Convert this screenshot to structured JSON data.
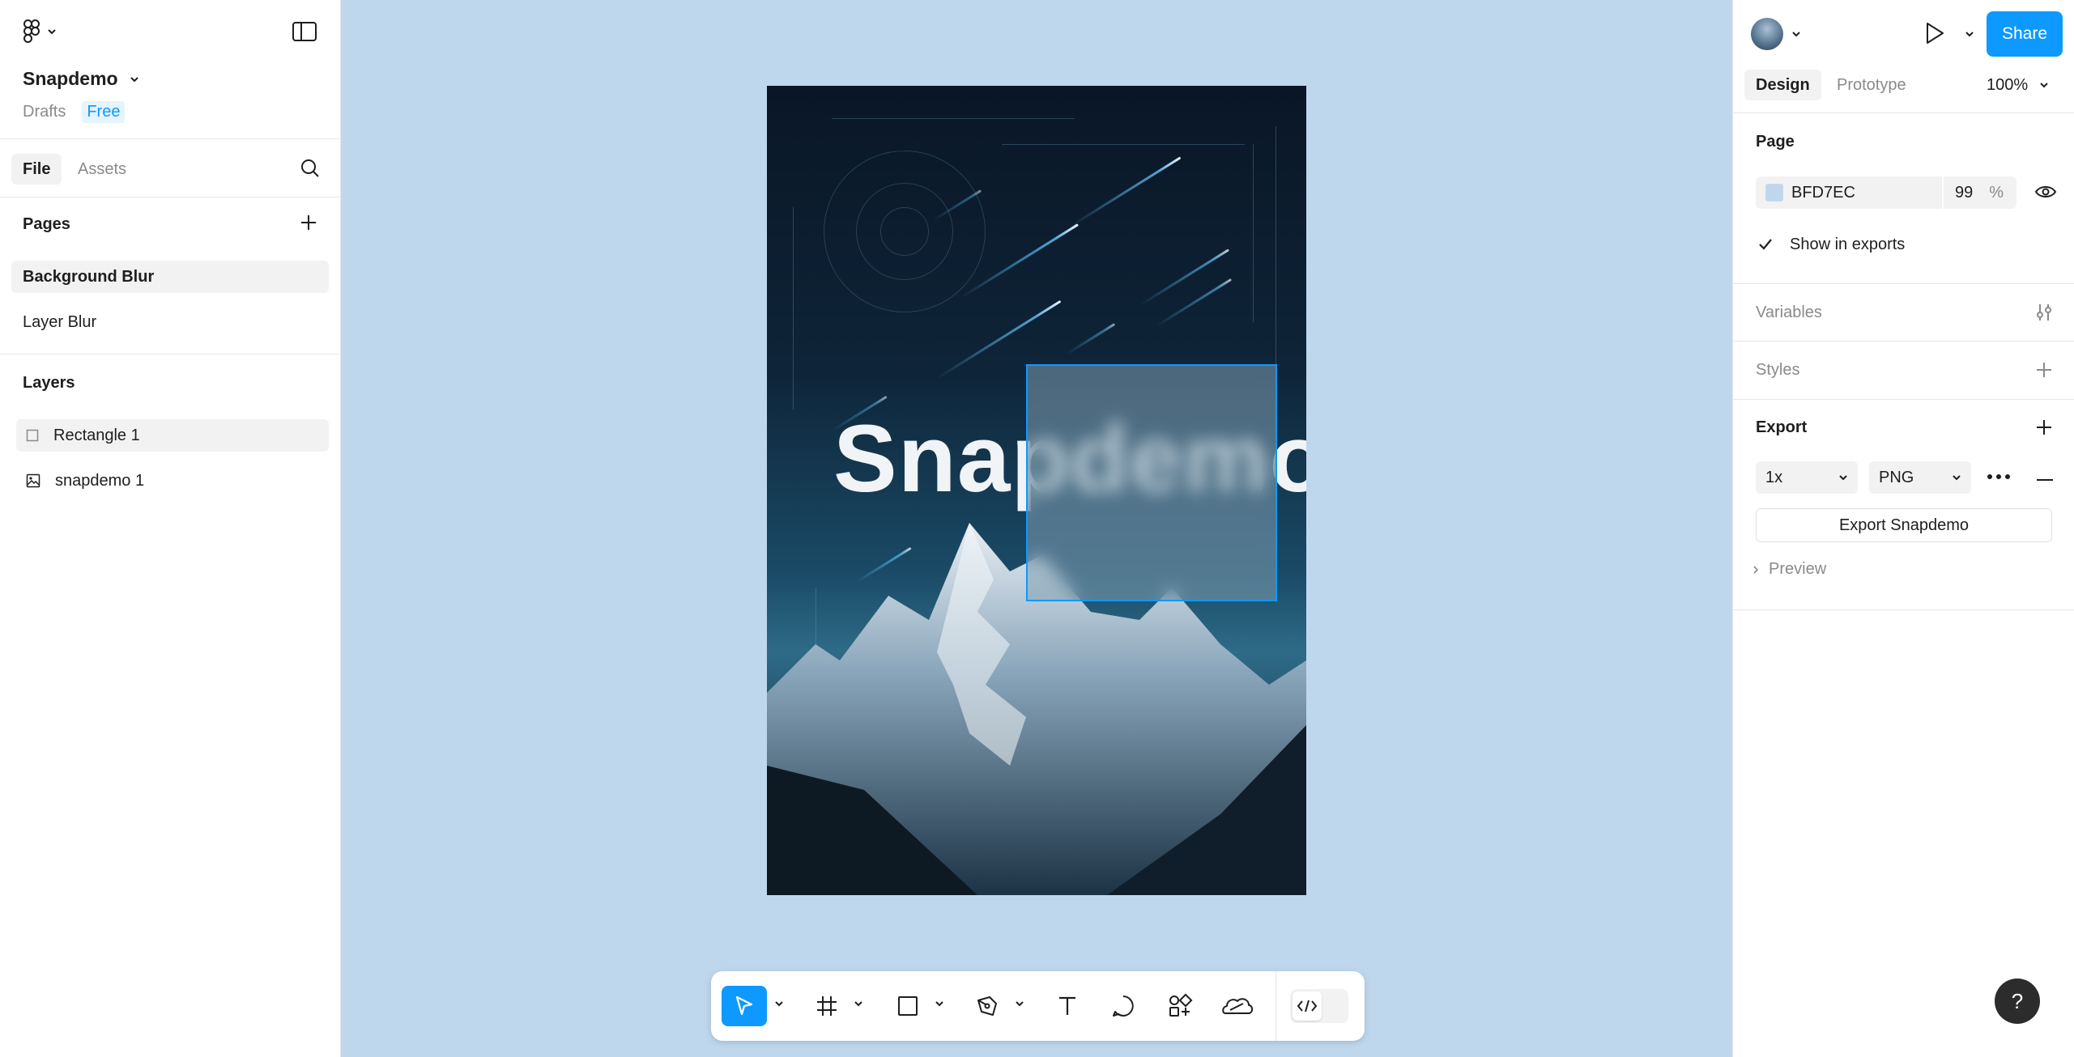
{
  "file": {
    "name": "Snapdemo",
    "location": "Drafts",
    "plan": "Free"
  },
  "left_tabs": [
    "File",
    "Assets"
  ],
  "pages": {
    "title": "Pages",
    "items": [
      "Background Blur",
      "Layer Blur"
    ]
  },
  "layers": {
    "title": "Layers",
    "items": [
      "Rectangle 1",
      "snapdemo 1"
    ]
  },
  "canvas": {
    "artboard_text": "Snapdemo",
    "background": "#bfd7ec"
  },
  "header": {
    "share_label": "Share"
  },
  "right_tabs": [
    "Design",
    "Prototype"
  ],
  "zoom": "100%",
  "page_panel": {
    "title": "Page",
    "color_hex": "BFD7EC",
    "opacity": "99",
    "opacity_unit": "%",
    "show_in_exports": "Show in exports"
  },
  "variables_title": "Variables",
  "styles_title": "Styles",
  "export": {
    "title": "Export",
    "scale": "1x",
    "format": "PNG",
    "button_label": "Export Snapdemo",
    "preview_label": "Preview"
  },
  "help_label": "?",
  "colors": {
    "accent": "#0d99ff",
    "canvas": "#bfd7ec",
    "panel_border": "#e6e6e6"
  }
}
